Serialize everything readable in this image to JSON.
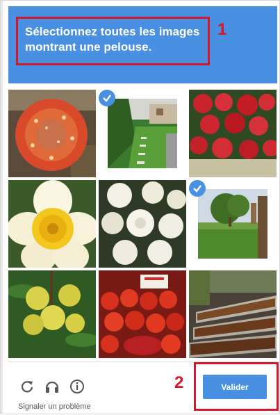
{
  "challenge": {
    "instruction_prefix": "Sélectionnez toutes les images montrant une",
    "instruction_object": "pelouse",
    "instruction_suffix": "."
  },
  "annotations": {
    "marker_1": "1",
    "marker_2": "2"
  },
  "tiles": [
    {
      "subject": "red mushroom cap",
      "selected": false
    },
    {
      "subject": "lawn path with hedge",
      "selected": true
    },
    {
      "subject": "red roses",
      "selected": false
    },
    {
      "subject": "yellow daffodil",
      "selected": false
    },
    {
      "subject": "white roses",
      "selected": false
    },
    {
      "subject": "tree on lawn",
      "selected": true
    },
    {
      "subject": "yellow fruits on branch",
      "selected": false
    },
    {
      "subject": "tomatoes at market",
      "selected": false
    },
    {
      "subject": "food trays on street",
      "selected": false
    }
  ],
  "footer": {
    "icons": [
      "reload-icon",
      "headphones-icon",
      "info-icon"
    ],
    "report_label": "Signaler un problème",
    "verify_label": "Valider"
  },
  "colors": {
    "accent": "#4a90e2",
    "annotation": "#d6172b"
  }
}
